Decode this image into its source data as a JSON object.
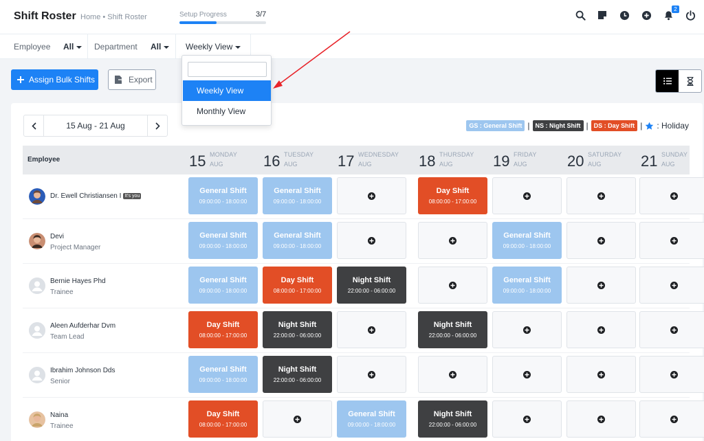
{
  "header": {
    "title": "Shift Roster",
    "breadcrumb": "Home • Shift Roster",
    "setup_label": "Setup Progress",
    "setup_count": "3/7",
    "setup_progress": 0.43,
    "notification_count": "2"
  },
  "filters": {
    "employee_label": "Employee",
    "employee_value": "All",
    "department_label": "Department",
    "department_value": "All",
    "view_value": "Weekly View"
  },
  "dropdown": {
    "search_value": "",
    "items": [
      "Weekly View",
      "Monthly View"
    ],
    "selected": "Weekly View"
  },
  "actions": {
    "assign_label": "Assign Bulk Shifts",
    "export_label": "Export"
  },
  "date_range": "15 Aug - 21 Aug",
  "legend": {
    "gs": "GS : General Shift",
    "ns": "NS : Night Shift",
    "ds": "DS : Day Shift",
    "holiday": ": Holiday",
    "sep": "|"
  },
  "table": {
    "employee_header": "Employee",
    "days": [
      {
        "num": "15",
        "name": "MONDAY",
        "month": "AUG"
      },
      {
        "num": "16",
        "name": "TUESDAY",
        "month": "AUG"
      },
      {
        "num": "17",
        "name": "WEDNESDAY",
        "month": "AUG"
      },
      {
        "num": "18",
        "name": "THURSDAY",
        "month": "AUG"
      },
      {
        "num": "19",
        "name": "FRIDAY",
        "month": "AUG"
      },
      {
        "num": "20",
        "name": "SATURDAY",
        "month": "AUG"
      },
      {
        "num": "21",
        "name": "SUNDAY",
        "month": "AUG"
      }
    ],
    "shift_labels": {
      "gs": {
        "name": "General Shift",
        "time": "09:00:00 - 18:00:00"
      },
      "ds": {
        "name": "Day Shift",
        "time": "08:00:00 - 17:00:00"
      },
      "ns": {
        "name": "Night Shift",
        "time": "22:00:00 - 06:00:00"
      }
    },
    "rows": [
      {
        "name": "Dr. Ewell Christiansen I",
        "role": "",
        "tag": "It's you",
        "avatar": "photo-1",
        "shifts": [
          "gs",
          "gs",
          "",
          "ds",
          "",
          "",
          ""
        ]
      },
      {
        "name": "Devi",
        "role": "Project Manager",
        "tag": "",
        "avatar": "photo-2",
        "shifts": [
          "gs",
          "gs",
          "",
          "",
          "gs",
          "",
          ""
        ]
      },
      {
        "name": "Bernie Hayes Phd",
        "role": "Trainee",
        "tag": "",
        "avatar": "generic",
        "shifts": [
          "gs",
          "ds",
          "ns",
          "",
          "gs",
          "",
          ""
        ]
      },
      {
        "name": "Aleen Aufderhar Dvm",
        "role": "Team Lead",
        "tag": "",
        "avatar": "generic",
        "shifts": [
          "ds",
          "ns",
          "",
          "ns",
          "",
          "",
          ""
        ]
      },
      {
        "name": "Ibrahim Johnson Dds",
        "role": "Senior",
        "tag": "",
        "avatar": "generic",
        "shifts": [
          "gs",
          "ns",
          "",
          "",
          "",
          "",
          ""
        ]
      },
      {
        "name": "Naina",
        "role": "Trainee",
        "tag": "",
        "avatar": "photo-3",
        "shifts": [
          "ds",
          "",
          "gs",
          "ns",
          "",
          "",
          ""
        ]
      }
    ]
  },
  "colors": {
    "primary": "#1d82f5",
    "general_shift": "#9dc6ef",
    "day_shift": "#e24e26",
    "night_shift": "#3f4042",
    "annotation_arrow": "#e8242a"
  }
}
